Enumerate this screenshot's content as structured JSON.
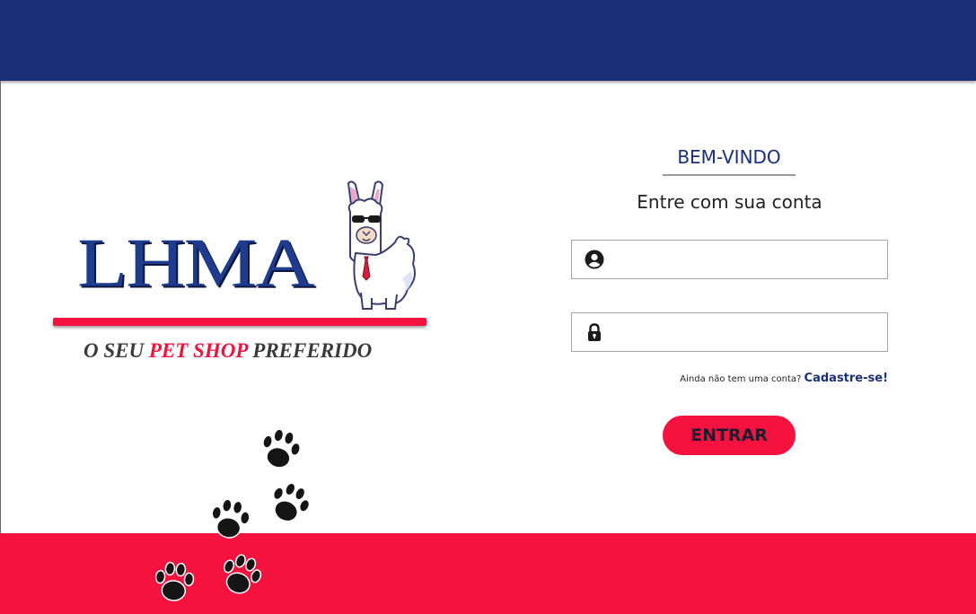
{
  "header": {},
  "brand": {
    "logo_text": "LHMA",
    "slogan_pre": "O SEU ",
    "slogan_highlight": "PET SHOP",
    "slogan_post": " PREFERIDO"
  },
  "login": {
    "welcome": "BEM-VINDO",
    "subtitle": "Entre com sua conta",
    "username_value": "",
    "password_value": "",
    "signup_prompt": "Ainda não tem uma conta? ",
    "signup_link": "Cadastre-se!",
    "submit_label": "ENTRAR"
  },
  "icons": {
    "user": "user-icon",
    "lock": "lock-icon",
    "llama": "llama-icon",
    "paw": "paw-icon"
  },
  "colors": {
    "navy": "#1a2f78",
    "red": "#f5123f"
  }
}
